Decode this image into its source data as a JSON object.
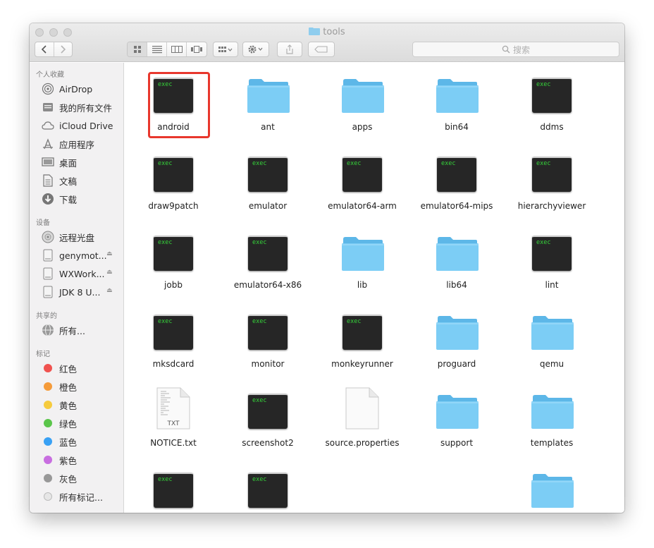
{
  "window": {
    "title": "tools"
  },
  "toolbar": {
    "back_icon": "chevron-left-icon",
    "forward_icon": "chevron-right-icon",
    "view_modes": [
      "icon-view",
      "list-view",
      "column-view",
      "cover-flow-view"
    ],
    "arrange_icon": "grid-arrange-icon",
    "action_icon": "gear-icon",
    "share_icon": "share-icon",
    "tags_icon": "tag-icon",
    "search_placeholder": "搜索"
  },
  "sidebar": {
    "favorites_header": "个人收藏",
    "favorites": [
      {
        "label": "AirDrop",
        "icon": "airdrop-icon"
      },
      {
        "label": "我的所有文件",
        "icon": "all-files-icon"
      },
      {
        "label": "iCloud Drive",
        "icon": "cloud-icon"
      },
      {
        "label": "应用程序",
        "icon": "applications-icon"
      },
      {
        "label": "桌面",
        "icon": "desktop-icon"
      },
      {
        "label": "文稿",
        "icon": "documents-icon"
      },
      {
        "label": "下载",
        "icon": "downloads-icon"
      }
    ],
    "devices_header": "设备",
    "devices": [
      {
        "label": "远程光盘",
        "icon": "disc-icon"
      },
      {
        "label": "genymot...",
        "icon": "disk-icon"
      },
      {
        "label": "WXWork...",
        "icon": "disk-icon"
      },
      {
        "label": "JDK 8 U...",
        "icon": "disk-icon"
      }
    ],
    "shared_header": "共享的",
    "shared": [
      {
        "label": "所有...",
        "icon": "network-icon"
      }
    ],
    "tags_header": "标记",
    "tags": [
      {
        "label": "红色",
        "color": "#f0524f"
      },
      {
        "label": "橙色",
        "color": "#f59b3a"
      },
      {
        "label": "黄色",
        "color": "#f6cb3d"
      },
      {
        "label": "绿色",
        "color": "#5ac54a"
      },
      {
        "label": "蓝色",
        "color": "#39a1f4"
      },
      {
        "label": "紫色",
        "color": "#c86ee0"
      },
      {
        "label": "灰色",
        "color": "#989898"
      },
      {
        "label": "所有标记...",
        "color": "#e6e6e6"
      }
    ]
  },
  "files": [
    {
      "name": "android",
      "kind": "exec",
      "selected": true
    },
    {
      "name": "ant",
      "kind": "folder"
    },
    {
      "name": "apps",
      "kind": "folder"
    },
    {
      "name": "bin64",
      "kind": "folder"
    },
    {
      "name": "ddms",
      "kind": "exec"
    },
    {
      "name": "draw9patch",
      "kind": "exec"
    },
    {
      "name": "emulator",
      "kind": "exec"
    },
    {
      "name": "emulator64-arm",
      "kind": "exec"
    },
    {
      "name": "emulator64-mips",
      "kind": "exec"
    },
    {
      "name": "hierarchyviewer",
      "kind": "exec"
    },
    {
      "name": "jobb",
      "kind": "exec"
    },
    {
      "name": "emulator64-x86",
      "kind": "exec"
    },
    {
      "name": "lib",
      "kind": "folder"
    },
    {
      "name": "lib64",
      "kind": "folder"
    },
    {
      "name": "lint",
      "kind": "exec"
    },
    {
      "name": "mksdcard",
      "kind": "exec"
    },
    {
      "name": "monitor",
      "kind": "exec"
    },
    {
      "name": "monkeyrunner",
      "kind": "exec"
    },
    {
      "name": "proguard",
      "kind": "folder"
    },
    {
      "name": "qemu",
      "kind": "folder"
    },
    {
      "name": "NOTICE.txt",
      "kind": "txt"
    },
    {
      "name": "screenshot2",
      "kind": "exec"
    },
    {
      "name": "source.properties",
      "kind": "doc"
    },
    {
      "name": "support",
      "kind": "folder"
    },
    {
      "name": "templates",
      "kind": "folder"
    },
    {
      "name": "",
      "kind": "exec"
    },
    {
      "name": "",
      "kind": "exec"
    },
    {
      "name": "",
      "kind": "none"
    },
    {
      "name": "",
      "kind": "none"
    },
    {
      "name": "",
      "kind": "folder"
    }
  ],
  "icon_text": {
    "exec": "exec",
    "txt": "TXT"
  },
  "colors": {
    "highlight": "#e8372d",
    "folder": "#7ccdf5",
    "exec_text": "#35d33a"
  }
}
